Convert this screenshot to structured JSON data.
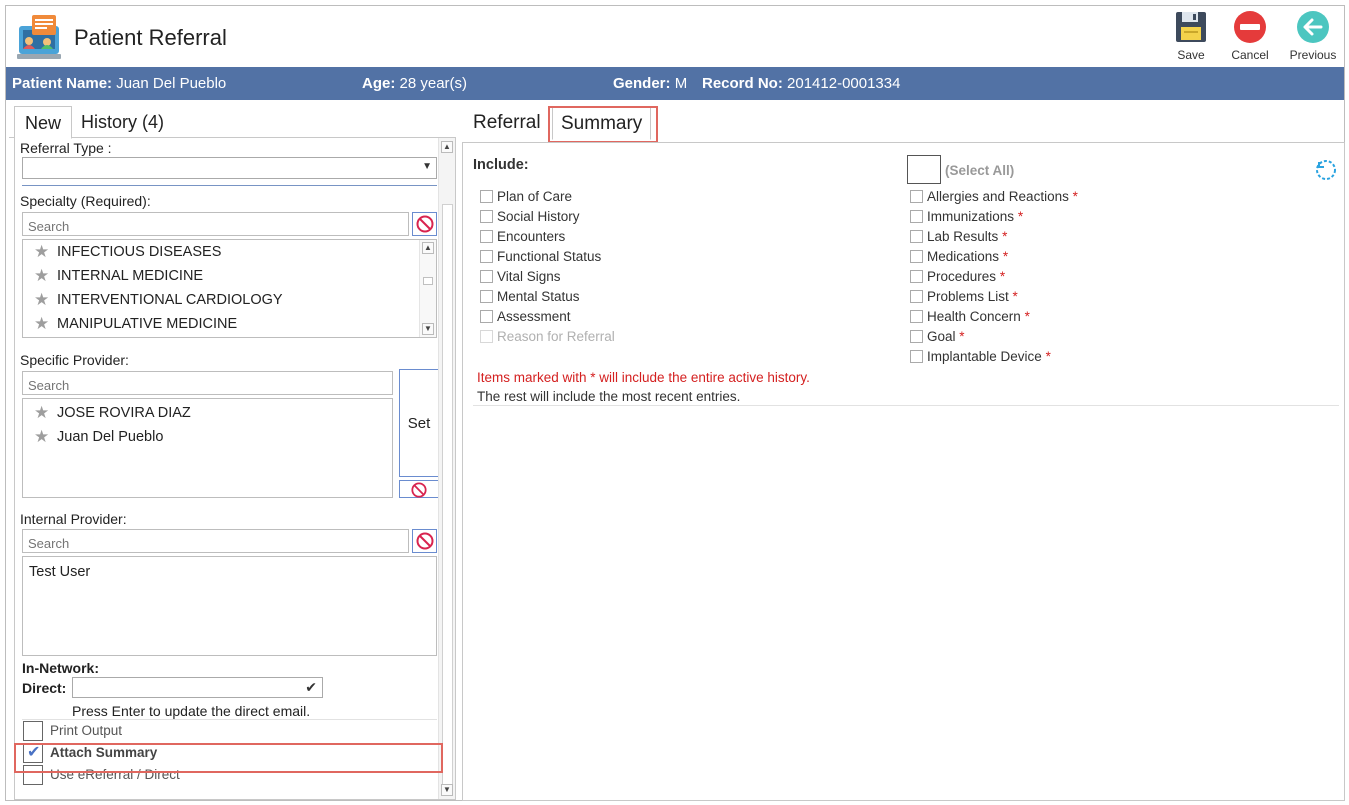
{
  "app": {
    "title": "Patient Referral"
  },
  "toolbar": {
    "save_label": "Save",
    "cancel_label": "Cancel",
    "previous_label": "Previous"
  },
  "patient": {
    "name_label": "Patient Name:",
    "name": "Juan Del Pueblo",
    "age_label": "Age:",
    "age": "28 year(s)",
    "gender_label": "Gender:",
    "gender": "M",
    "record_label": "Record No:",
    "record": "201412-0001334"
  },
  "left_tabs": {
    "new": "New",
    "history": "History",
    "history_count": "(4)"
  },
  "form": {
    "referral_type_label": "Referral Type :",
    "referral_type_value": "",
    "specialty_label": "Specialty (Required):",
    "specialty_search_placeholder": "Search",
    "specialties": [
      "INFECTIOUS DISEASES",
      "INTERNAL MEDICINE",
      "INTERVENTIONAL CARDIOLOGY",
      "MANIPULATIVE MEDICINE"
    ],
    "specific_provider_label": "Specific Provider:",
    "provider_search_placeholder": "Search",
    "providers": [
      "JOSE ROVIRA DIAZ",
      "Juan  Del Pueblo"
    ],
    "set_label": "Set",
    "internal_provider_label": "Internal Provider:",
    "internal_search_placeholder": "Search",
    "internal_providers": [
      "Test User"
    ],
    "in_network_label": "In-Network:",
    "direct_label": "Direct:",
    "direct_value": "",
    "direct_hint": "Press Enter to update the direct email.",
    "print_output_label": "Print Output",
    "print_output_checked": false,
    "attach_summary_label": "Attach Summary",
    "attach_summary_checked": true,
    "use_ereferral_label": "Use eReferral / Direct",
    "use_ereferral_checked": false
  },
  "right_tabs": {
    "referral": "Referral",
    "summary": "Summary"
  },
  "summary": {
    "include_label": "Include:",
    "select_all_label": "(Select All)",
    "left_options": [
      {
        "label": "Plan of Care",
        "checked": false,
        "disabled": false
      },
      {
        "label": "Social History",
        "checked": false,
        "disabled": false
      },
      {
        "label": "Encounters",
        "checked": false,
        "disabled": false
      },
      {
        "label": "Functional Status",
        "checked": false,
        "disabled": false
      },
      {
        "label": "Vital Signs",
        "checked": false,
        "disabled": false
      },
      {
        "label": "Mental Status",
        "checked": false,
        "disabled": false
      },
      {
        "label": "Assessment",
        "checked": false,
        "disabled": false
      },
      {
        "label": "Reason for Referral",
        "checked": false,
        "disabled": true
      }
    ],
    "right_options": [
      {
        "label": "Allergies and Reactions",
        "checked": false
      },
      {
        "label": "Immunizations",
        "checked": false
      },
      {
        "label": "Lab Results",
        "checked": false
      },
      {
        "label": "Medications",
        "checked": false
      },
      {
        "label": "Procedures",
        "checked": false
      },
      {
        "label": "Problems List",
        "checked": false
      },
      {
        "label": "Health Concern",
        "checked": false
      },
      {
        "label": "Goal",
        "checked": false
      },
      {
        "label": "Implantable Device",
        "checked": false
      }
    ],
    "asterisk": "*",
    "note_red": "Items marked with * will include the entire active history.",
    "note": "The rest will include the most recent entries."
  },
  "colors": {
    "patient_bar": "#5272a5",
    "highlight": "#e0675f",
    "required_star": "#d42020",
    "accent": "#6a8ccf"
  }
}
